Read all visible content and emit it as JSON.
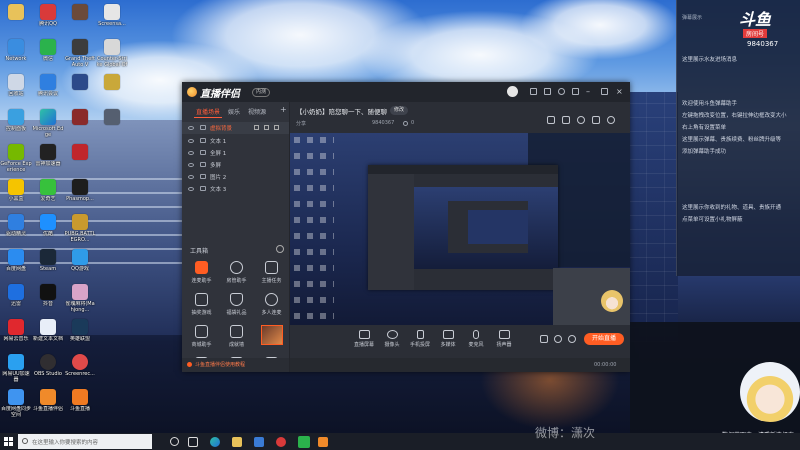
{
  "desktop": {
    "icons": [
      {
        "label": "",
        "icon": "user-folder-icon"
      },
      {
        "label": "Network",
        "icon": "network-icon"
      },
      {
        "label": "回收站",
        "icon": "recycle-bin-icon"
      },
      {
        "label": "控制面板",
        "icon": "control-panel-icon"
      },
      {
        "label": "GeForce Experience",
        "icon": "geforce-icon"
      },
      {
        "label": "小黑盒",
        "icon": "heybox-icon"
      },
      {
        "label": "驱动精灵",
        "icon": "driver-icon"
      },
      {
        "label": "百度网盘",
        "icon": "baidu-netdisk-icon"
      },
      {
        "label": "迅雷",
        "icon": "thunder-icon"
      },
      {
        "label": "网易云音乐",
        "icon": "netease-music-icon"
      },
      {
        "label": "网易UU加速器",
        "icon": "uu-accelerator-icon"
      },
      {
        "label": "百度网盘同步空间",
        "icon": "sync-space-icon"
      },
      {
        "label": "腾讯QQ",
        "icon": "qq-icon"
      },
      {
        "label": "微信",
        "icon": "wechat-icon"
      },
      {
        "label": "腾讯会议",
        "icon": "tencent-meeting-icon"
      },
      {
        "label": "Microsoft Edge",
        "icon": "edge-icon"
      },
      {
        "label": "雷神加速器",
        "icon": "leishen-icon"
      },
      {
        "label": "爱奇艺",
        "icon": "iqiyi-icon"
      },
      {
        "label": "优酷",
        "icon": "youku-icon"
      },
      {
        "label": "Steam",
        "icon": "steam-icon"
      },
      {
        "label": "抖音",
        "icon": "douyin-icon"
      },
      {
        "label": "新建文本文档",
        "icon": "text-document-icon"
      },
      {
        "label": "OBS Studio",
        "icon": "obs-icon"
      },
      {
        "label": "斗鱼直播伴侣",
        "icon": "douyu-companion-icon"
      },
      {
        "label": "",
        "icon": "game-icon"
      },
      {
        "label": "Grand Theft Auto V",
        "icon": "gta-icon"
      },
      {
        "label": "",
        "icon": "game-icon"
      },
      {
        "label": "",
        "icon": "game-icon"
      },
      {
        "label": "",
        "icon": "game-icon"
      },
      {
        "label": "Phasmop...",
        "icon": "phasmophobia-icon"
      },
      {
        "label": "PUBG BATTLEGRO...",
        "icon": "pubg-icon"
      },
      {
        "label": "QQ游戏",
        "icon": "qq-game-icon"
      },
      {
        "label": "雀魂麻将(Mahjong...",
        "icon": "mahjong-icon"
      },
      {
        "label": "英雄联盟",
        "icon": "lol-icon"
      },
      {
        "label": "Screenrec...",
        "icon": "screenrec-icon"
      },
      {
        "label": "斗鱼直播",
        "icon": "douyu-icon"
      },
      {
        "label": "Screensa...",
        "icon": "screensaver-icon"
      },
      {
        "label": "Counter-Strike Global Off...",
        "icon": "csgo-icon"
      },
      {
        "label": "",
        "icon": "game-icon"
      },
      {
        "label": "",
        "icon": "game-icon"
      }
    ]
  },
  "app": {
    "title": "直播伴侣",
    "version_badge": "内测",
    "tabs": [
      "直播场景",
      "娱乐",
      "视频源"
    ],
    "add_tab": "+",
    "scene_header": "虚拟背景",
    "sources": [
      "文本 1",
      "全屏 1",
      "多屏",
      "图片 2",
      "文本 3"
    ],
    "toolbox_title": "工具箱",
    "tools": [
      "连麦助手",
      "房管助手",
      "主播任务",
      "抽奖游戏",
      "福袋礼品",
      "多人连麦",
      "商城助手",
      "成就墙"
    ],
    "tutorial": "斗鱼直播伴侣使用教程",
    "room_title": "【小奶奶】陪您聊一下、随便聊",
    "edit_label": "修改",
    "share_label": "分享",
    "room_id": "9840367",
    "viewer_count": "0",
    "bottom_tools": [
      "直播屏幕",
      "摄像头",
      "手机投屏",
      "多媒体",
      "麦克风",
      "扬声器"
    ],
    "start_label": "开始直播",
    "timer": "00:00:00"
  },
  "danmu": {
    "header": "弹幕展示",
    "logo_text": "斗鱼",
    "room_badge": "房间号",
    "room_id": "9840367",
    "entry_hint": "这里展示水友进场消息",
    "messages": [
      "欢迎使用斗鱼弹幕助手",
      "左键拖拽改变位置，右键拉伸边框改变大小",
      "右上角有设置菜单",
      "这里展示弹幕、贵族续费、粉丝牌升级等",
      "添加弹幕助手成功"
    ],
    "gift_hints": [
      "这里展示你收到的礼物、道具、贵族开通",
      "点菜单可设置小礼物屏蔽"
    ]
  },
  "status_panel": {
    "message": "数据获取中，请重新选择直..."
  },
  "taskbar": {
    "search_placeholder": "在这里输入你要搜索的内容"
  },
  "watermark": "微博：潇次",
  "colors": {
    "accent": "#ff5d23",
    "window": "#2b2e36",
    "danmu_panel": "#18223a"
  }
}
